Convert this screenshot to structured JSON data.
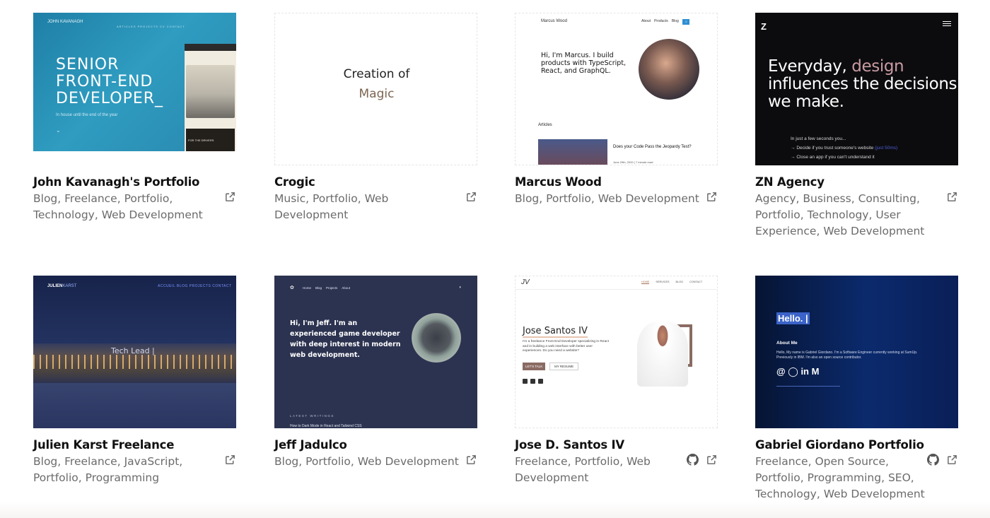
{
  "cards": [
    {
      "title": "John Kavanagh's Portfolio",
      "tags": [
        "Blog",
        "Freelance",
        "Portfolio",
        "Technology",
        "Web Development"
      ],
      "has_github": false,
      "thumb": {
        "logo": "JOHN KAVANAGH",
        "nav": "ARTICLES   PROJECTS   CV   CONTACT",
        "hero": [
          "SENIOR",
          "FRONT-END",
          "DEVELOPER_"
        ],
        "sub": "In house until the end of the year",
        "side_caption": "FOR THE DRIVERS"
      }
    },
    {
      "title": "Crogic",
      "tags": [
        "Music",
        "Portfolio",
        "Web Development"
      ],
      "has_github": false,
      "thumb": {
        "line1": "Creation of",
        "line2": "Magic"
      }
    },
    {
      "title": "Marcus Wood",
      "tags": [
        "Blog",
        "Portfolio",
        "Web Development"
      ],
      "has_github": false,
      "thumb": {
        "brand": "Marcus Wood",
        "nav": [
          "About",
          "Products",
          "Blog"
        ],
        "intro": "Hi, I'm Marcus. I build products with TypeScript, React, and GraphQL.",
        "section": "Articles",
        "article_title": "Does your Code Pass the Jeopardy Test?",
        "article_date": "June 29th, 2020 | 7 minute read"
      }
    },
    {
      "title": "ZN Agency",
      "tags": [
        "Agency",
        "Business",
        "Consulting",
        "Portfolio",
        "Technology",
        "User Experience",
        "Web Development"
      ],
      "has_github": false,
      "thumb": {
        "logo": "Z",
        "head_pre": "Everyday, ",
        "head_hl": "design",
        "head_rest": "influences the decisions we make.",
        "line1": "In just a few seconds you...",
        "line2": "Decide if you trust someone's website",
        "line2_link": "(just 50ms)",
        "line3": "Close an app if you can't understand it"
      }
    },
    {
      "title": "Julien Karst Freelance",
      "tags": [
        "Blog",
        "Freelance",
        "JavaScript",
        "Portfolio",
        "Programming"
      ],
      "has_github": false,
      "thumb": {
        "brand": "JULIEN",
        "brand_accent": "KARST",
        "nav": "ACCUEIL   BLOG   PROJECTS   CONTACT",
        "text": "Tech Lead |"
      }
    },
    {
      "title": "Jeff Jadulco",
      "tags": [
        "Blog",
        "Portfolio",
        "Web Development"
      ],
      "has_github": false,
      "thumb": {
        "nav": [
          "Home",
          "Blog",
          "Projects",
          "About"
        ],
        "intro": "Hi, I'm Jeff. I'm an experienced game developer with deep interest in modern web development.",
        "latest": "LATEST WRITINGS",
        "post": "How to Dark Mode in React and Tailwind CSS"
      }
    },
    {
      "title": "Jose D. Santos IV",
      "tags": [
        "Freelance",
        "Portfolio",
        "Web Development"
      ],
      "has_github": true,
      "thumb": {
        "logo": "JV",
        "nav": [
          "HOME",
          "SERVICES",
          "BLOG",
          "CONTACT"
        ],
        "name": "Jose Santos IV",
        "bio": "I'm a freelance Front End Developer specializing in React and in building a web interface with better user experiences. Do you need a website?",
        "btn1": "LET'S TALK",
        "btn2": "MY RESUME"
      }
    },
    {
      "title": "Gabriel Giordano Portfolio",
      "tags": [
        "Freelance",
        "Open Source",
        "Portfolio",
        "Programming",
        "SEO",
        "Technology",
        "Web Development"
      ],
      "has_github": true,
      "thumb": {
        "hello": "Hello. |",
        "about": "About Me",
        "bio": "Hello, My name is Gabriel Giordano. I'm a Software Engineer currently working at SumUp. Previously in IBM. I'm also an open source contributor.",
        "icons": "@  ◯  in  M"
      }
    }
  ]
}
